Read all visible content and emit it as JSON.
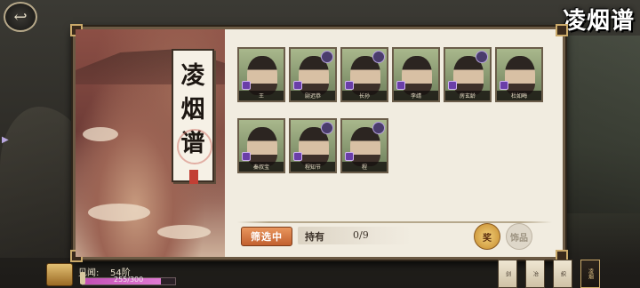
{
  "header": {
    "logo_text": "凌烟谱",
    "back_icon": "back-arrow-icon"
  },
  "scroll": {
    "title_chars": [
      "凌",
      "烟",
      "谱"
    ]
  },
  "cards": [
    {
      "name": "王",
      "row": 0,
      "col": 0
    },
    {
      "name": "尉迟恭",
      "row": 0,
      "col": 1
    },
    {
      "name": "长孙",
      "row": 0,
      "col": 2
    },
    {
      "name": "李靖",
      "row": 0,
      "col": 3
    },
    {
      "name": "房玄龄",
      "row": 0,
      "col": 4
    },
    {
      "name": "杜如晦",
      "row": 0,
      "col": 5
    },
    {
      "name": "秦叔宝",
      "row": 1,
      "col": 0
    },
    {
      "name": "程知节",
      "row": 1,
      "col": 1
    },
    {
      "name": "程",
      "row": 1,
      "col": 2
    }
  ],
  "filter": {
    "button_label": "筛选中",
    "owned_label": "持有",
    "owned_value": "0/9"
  },
  "actions": {
    "icon_a_label": "奖",
    "icon_b_label": "饰品"
  },
  "player": {
    "insight_label": "见闻:",
    "insight_level": "54阶",
    "xp_text": "255/300",
    "xp_fraction": 0.85
  },
  "bottom_tabs": [
    "剑",
    "冶",
    "织",
    "凌烟"
  ],
  "colors": {
    "accent": "#c2602f",
    "panel": "#f1ece0",
    "xp": "#c24fb4"
  }
}
